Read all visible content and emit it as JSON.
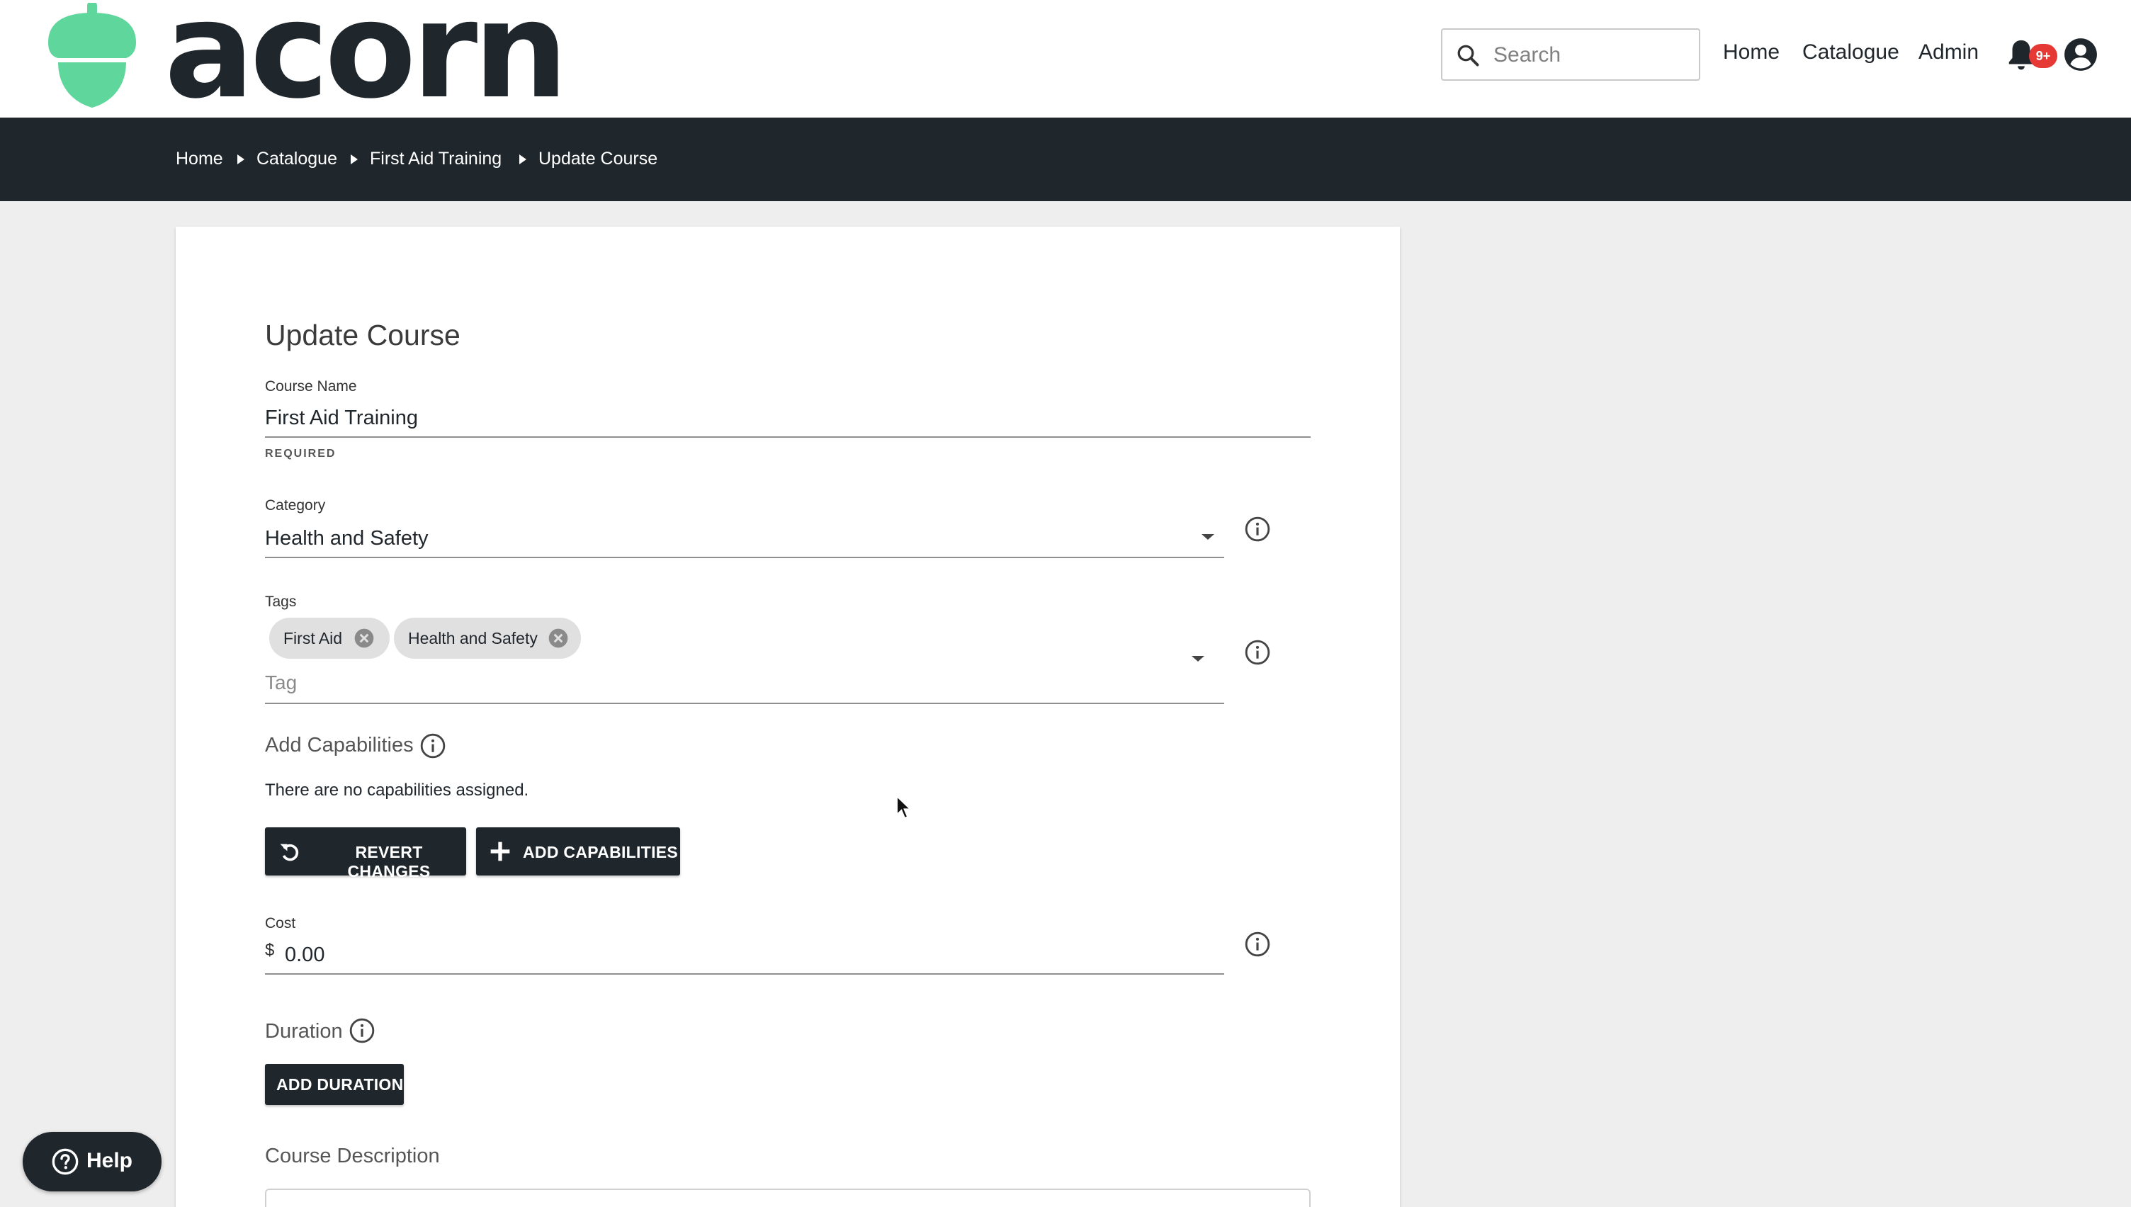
{
  "brand": {
    "name": "acorn",
    "color": "#5fd69b"
  },
  "header": {
    "search_placeholder": "Search",
    "nav": [
      "Home",
      "Catalogue",
      "Admin"
    ],
    "notification_badge": "9+"
  },
  "breadcrumb": [
    "Home",
    "Catalogue",
    "First Aid Training",
    "Update Course"
  ],
  "form": {
    "title": "Update Course",
    "course_name": {
      "label": "Course Name",
      "value": "First Aid Training",
      "hint": "REQUIRED"
    },
    "category": {
      "label": "Category",
      "value": "Health and Safety"
    },
    "tags": {
      "label": "Tags",
      "chips": [
        "First Aid",
        "Health and Safety"
      ],
      "placeholder": "Tag"
    },
    "capabilities": {
      "heading": "Add Capabilities",
      "empty_text": "There are no capabilities assigned.",
      "revert_label": "REVERT CHANGES",
      "add_label": "ADD CAPABILITIES"
    },
    "cost": {
      "label": "Cost",
      "currency": "$",
      "value": "0.00"
    },
    "duration": {
      "heading": "Duration",
      "add_label": "ADD DURATION"
    },
    "description": {
      "heading": "Course Description"
    }
  },
  "help": {
    "label": "Help"
  },
  "colors": {
    "dark": "#1f262c",
    "badge": "#e53935",
    "chip": "#e0e0e0"
  }
}
